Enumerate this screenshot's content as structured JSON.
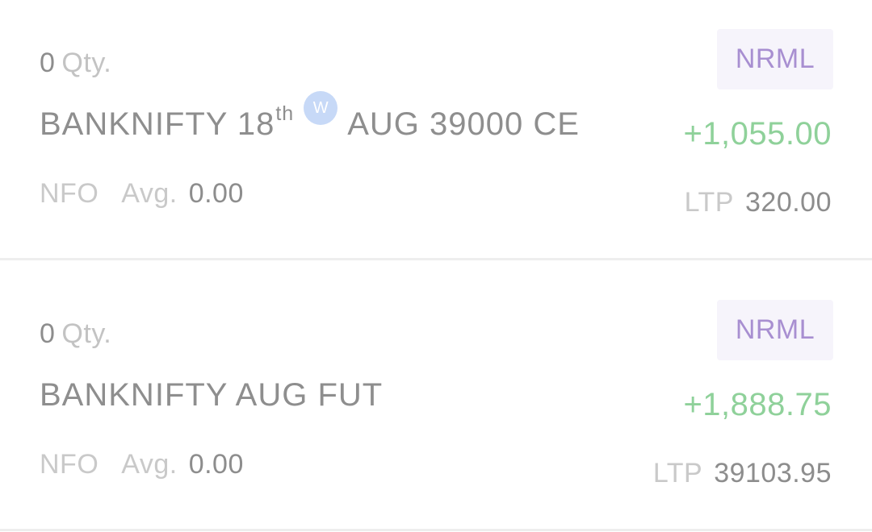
{
  "positions": [
    {
      "qty": "0",
      "qty_label": "Qty.",
      "symbol_prefix": "BANKNIFTY 18",
      "symbol_suffix": "th",
      "weekly_badge": "W",
      "symbol_rest": "AUG 39000 CE",
      "product": "NRML",
      "pnl": "+1,055.00",
      "exchange": "NFO",
      "avg_label": "Avg.",
      "avg_value": "0.00",
      "ltp_label": "LTP",
      "ltp_value": "320.00"
    },
    {
      "qty": "0",
      "qty_label": "Qty.",
      "symbol": "BANKNIFTY AUG FUT",
      "product": "NRML",
      "pnl": "+1,888.75",
      "exchange": "NFO",
      "avg_label": "Avg.",
      "avg_value": "0.00",
      "ltp_label": "LTP",
      "ltp_value": "39103.95"
    }
  ],
  "colors": {
    "profit": "#8fd19a",
    "product_tag_text": "#a88fd1",
    "product_tag_bg": "#f6f4fb",
    "weekly_badge_bg": "#c7d9f7"
  }
}
